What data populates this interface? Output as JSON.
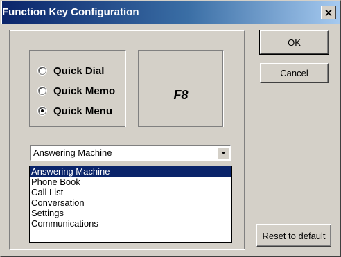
{
  "window": {
    "title": "Function Key Configuration"
  },
  "mode_options": [
    {
      "label": "Quick Dial",
      "selected": false
    },
    {
      "label": "Quick Memo",
      "selected": false
    },
    {
      "label": "Quick Menu",
      "selected": true
    }
  ],
  "key_display": "F8",
  "buttons": {
    "ok": "OK",
    "cancel": "Cancel",
    "reset": "Reset to default"
  },
  "dropdown": {
    "selected": "Answering Machine",
    "options": [
      "Answering Machine",
      "Phone Book",
      "Call List",
      "Conversation",
      "Settings",
      "Communications"
    ],
    "highlighted_index": 0
  },
  "colors": {
    "title_start": "#0a246a",
    "title_end": "#a6caf0",
    "face": "#d4d0c8",
    "selection": "#0a246a"
  },
  "icons": {
    "close": "close-icon",
    "dropdown": "chevron-down-icon"
  }
}
